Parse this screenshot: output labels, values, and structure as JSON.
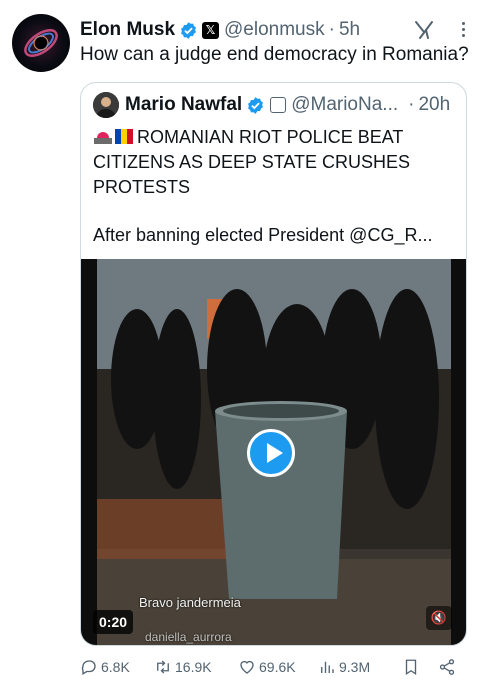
{
  "tweet": {
    "author_name": "Elon Musk",
    "handle": "@elonmusk",
    "separator": "·",
    "time": "5h",
    "text": "How can a judge end democracy in Romania?"
  },
  "quote": {
    "author_name": "Mario Nawfal",
    "handle": "@MarioNa...",
    "separator": "·",
    "time": "20h",
    "line1": "ROMANIAN RIOT POLICE BEAT",
    "line2": "CITIZENS AS DEEP STATE CRUSHES",
    "line3": "PROTESTS",
    "after": "After banning elected President @CG_R..."
  },
  "video": {
    "duration": "0:20",
    "caption": "Bravo jandermeia",
    "caption2": "daniella_aurrora"
  },
  "actions": {
    "replies": "6.8K",
    "reposts": "16.9K",
    "likes": "69.6K",
    "views": "9.3M"
  },
  "colors": {
    "accent": "#1d9bf0",
    "muted": "#536471",
    "text": "#0f1419",
    "border": "#cfd9de"
  }
}
